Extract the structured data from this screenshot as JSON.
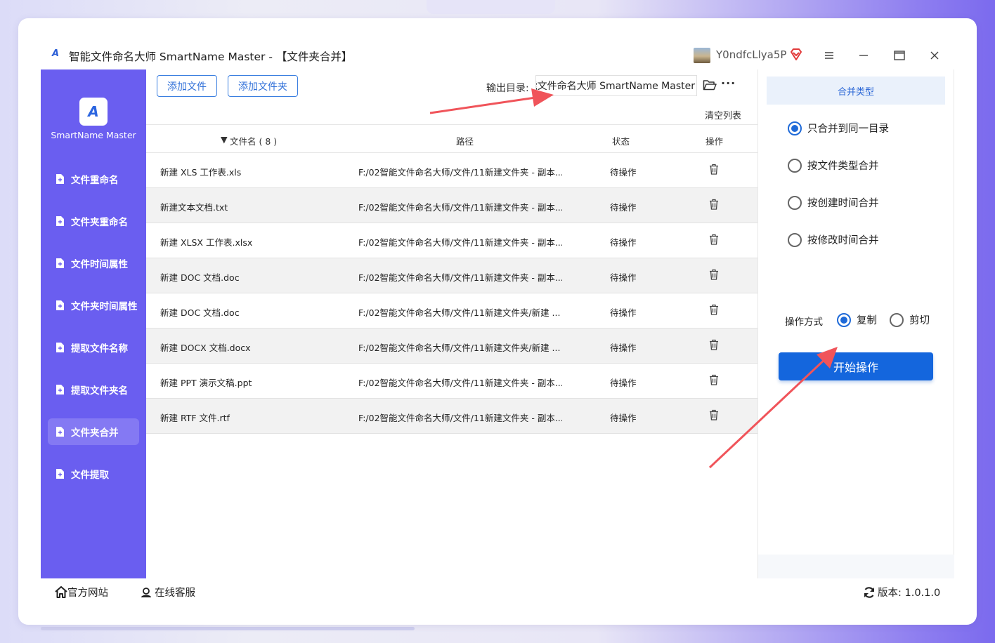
{
  "window": {
    "title": "智能文件命名大师 SmartName Master - 【文件夹合并】",
    "username": "Y0ndfcLlya5P",
    "logo_glyph": "A"
  },
  "sidebar": {
    "brand": "SmartName Master",
    "logo_glyph": "A",
    "items": [
      {
        "label": "文件重命名"
      },
      {
        "label": "文件夹重命名"
      },
      {
        "label": "文件时间属性"
      },
      {
        "label": "文件夹时间属性"
      },
      {
        "label": "提取文件名称"
      },
      {
        "label": "提取文件夹名"
      },
      {
        "label": "文件夹合并",
        "active": true
      },
      {
        "label": "文件提取"
      }
    ]
  },
  "toolbar": {
    "add_file": "添加文件",
    "add_folder": "添加文件夹",
    "output_label": "输出目录:",
    "output_value": "能文件命名大师 SmartName Master",
    "more": "···",
    "clear_list": "清空列表"
  },
  "table": {
    "headers": {
      "name": "文件名 ( 8 )",
      "path": "路径",
      "status": "状态",
      "op": "操作"
    },
    "rows": [
      {
        "name": "新建 XLS 工作表.xls",
        "path": "F:/02智能文件命名大师/文件/11新建文件夹 - 副本...",
        "status": "待操作"
      },
      {
        "name": "新建文本文档.txt",
        "path": "F:/02智能文件命名大师/文件/11新建文件夹 - 副本...",
        "status": "待操作"
      },
      {
        "name": "新建 XLSX 工作表.xlsx",
        "path": "F:/02智能文件命名大师/文件/11新建文件夹 - 副本...",
        "status": "待操作"
      },
      {
        "name": "新建 DOC 文档.doc",
        "path": "F:/02智能文件命名大师/文件/11新建文件夹 - 副本...",
        "status": "待操作"
      },
      {
        "name": "新建 DOC 文档.doc",
        "path": "F:/02智能文件命名大师/文件/11新建文件夹/新建 ...",
        "status": "待操作"
      },
      {
        "name": "新建 DOCX 文档.docx",
        "path": "F:/02智能文件命名大师/文件/11新建文件夹/新建 ...",
        "status": "待操作"
      },
      {
        "name": "新建 PPT 演示文稿.ppt",
        "path": "F:/02智能文件命名大师/文件/11新建文件夹 - 副本...",
        "status": "待操作"
      },
      {
        "name": "新建 RTF 文件.rtf",
        "path": "F:/02智能文件命名大师/文件/11新建文件夹 - 副本...",
        "status": "待操作"
      }
    ]
  },
  "right_panel": {
    "merge_type_title": "合并类型",
    "options": [
      {
        "label": "只合并到同一目录",
        "selected": true
      },
      {
        "label": "按文件类型合并",
        "selected": false
      },
      {
        "label": "按创建时间合并",
        "selected": false
      },
      {
        "label": "按修改时间合并",
        "selected": false
      }
    ],
    "op_mode_label": "操作方式",
    "op_modes": [
      {
        "label": "复制",
        "selected": true
      },
      {
        "label": "剪切",
        "selected": false
      }
    ],
    "start_button": "开始操作"
  },
  "footer": {
    "website": "官方网站",
    "support": "在线客服",
    "version": "版本: 1.0.1.0"
  },
  "colors": {
    "sidebar": "#6a5ef0",
    "accent": "#1466dd",
    "arrow": "#f0545a"
  }
}
